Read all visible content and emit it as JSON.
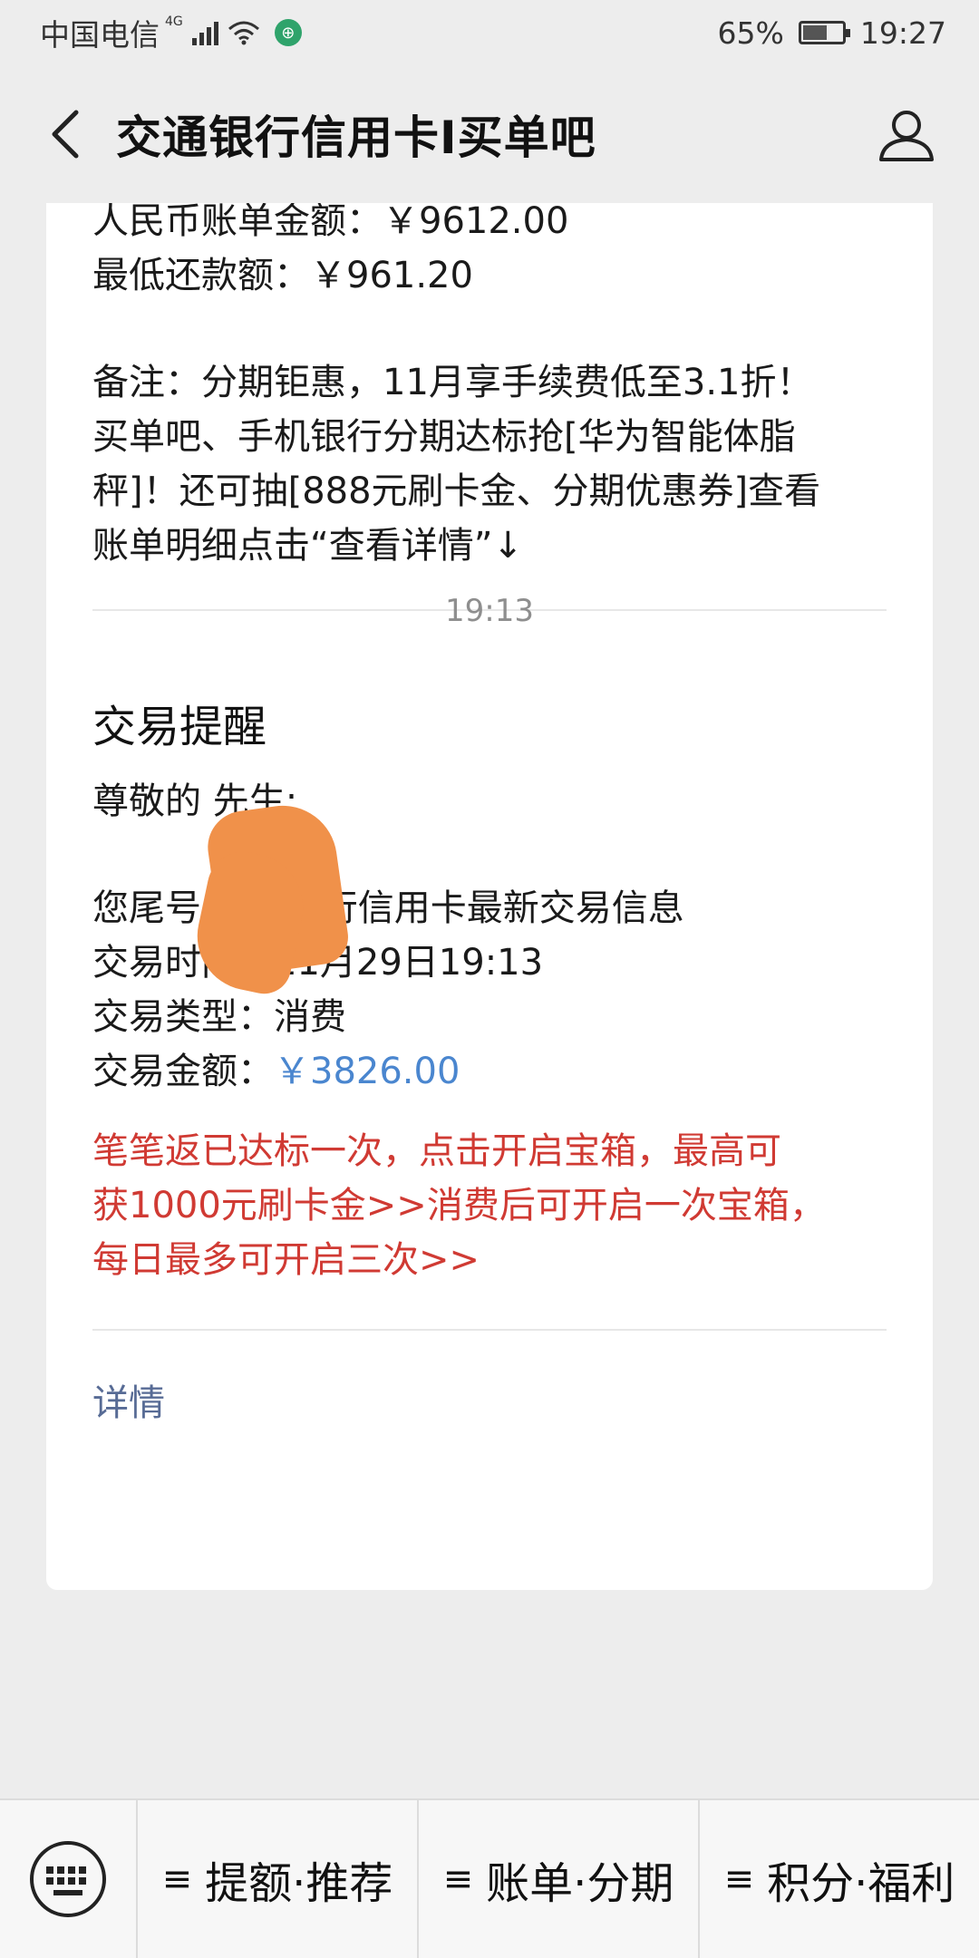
{
  "status_bar": {
    "carrier": "中国电信",
    "network": "4G",
    "battery_percent": "65%",
    "battery_level": 0.65,
    "time": "19:27"
  },
  "nav": {
    "title": "交通银行信用卡I买单吧"
  },
  "bill_card": {
    "lines": [
      "人民币账单金额：￥9612.00",
      "最低还款额：￥961.20"
    ],
    "note_lines": [
      "备注：分期钜惠，11月享手续费低至3.1折！",
      "买单吧、手机银行分期达标抢[华为智能体脂",
      "秤]！还可抽[888元刷卡金、分期优惠券]查看",
      "账单明细点击“查看详情”↓"
    ],
    "detail_label": "详情"
  },
  "time_separator": "19:13",
  "transaction_card": {
    "title": "交易提醒",
    "greeting": "尊敬的        先生:",
    "intro": "您尾号        交通银行信用卡最新交易信息",
    "time_line": "交易时间：11月29日19:13",
    "type_line": "交易类型：消费",
    "amount_label": "交易金额：",
    "amount_value": "￥3826.00",
    "promo_lines": [
      "笔笔返已达标一次，点击开启宝箱，最高可",
      "获1000元刷卡金>>消费后可开启一次宝箱，",
      "每日最多可开启三次>>"
    ],
    "detail_label": "详情"
  },
  "bottom_menu": {
    "items": [
      {
        "label": "提额·推荐"
      },
      {
        "label": "账单·分期"
      },
      {
        "label": "积分·福利"
      }
    ],
    "menu_glyph": "≡"
  },
  "colors": {
    "link": "#576b95",
    "amount": "#4a86cf",
    "promo": "#d03a33",
    "redaction": "#f0914a"
  }
}
